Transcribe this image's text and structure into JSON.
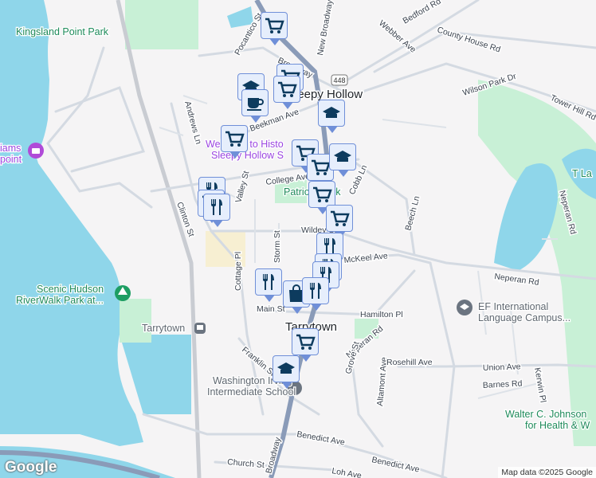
{
  "colors": {
    "water": "#8fd6ea",
    "park": "#c8f0d6",
    "road": "#d4dae2",
    "highway": "#8a9bb8",
    "marker_fill": "#e6eefc",
    "marker_border": "#6f8fd8",
    "marker_icon": "#0d3b5e"
  },
  "labels": {
    "kingsland": "Kingsland Point Park",
    "williams_1": "iams",
    "williams_2": "point",
    "scenic_1": "Scenic Hudson",
    "scenic_2": "RiverWalk Park at...",
    "tarrytown_station": "Tarrytown",
    "welcome_1": "Welcome to Histo",
    "welcome_2": "Sleepy Hollow S",
    "sleepy_hollow": "Sleepy Hollow",
    "patriots_park": "Patriots Park",
    "tarrytown": "Tarrytown",
    "ef_1": "EF International",
    "ef_2": "Language Campus...",
    "wis_1": "Washington Irving",
    "wis_2": "Intermediate School",
    "walter_1": "Walter C. Johnson",
    "walter_2": "for Health & W",
    "tarrytown_lakes": "T La",
    "route": "448"
  },
  "streets": [
    "Pocantico St",
    "Broadway",
    "New Broadway",
    "Webber Ave",
    "Bedford Rd",
    "County House Rd",
    "Wilson Park Dr",
    "Tower Hill Rd",
    "Andrews Ln",
    "Beekman Ave",
    "Clinton St",
    "Valley St",
    "College Ave",
    "Cobb Ln",
    "Beech Ln",
    "Neperan Rd",
    "Wildey St",
    "Cottage Pl",
    "Storm St",
    "McKeel Ave",
    "Main St",
    "Hamilton Pl",
    "Neperan Rd",
    "Grove St",
    "Altamont Ave",
    "Rosehill Ave",
    "Union Ave",
    "Barnes Rd",
    "Kerwin Pl",
    "Franklin St",
    "Benedict Ave",
    "Benedict Ave",
    "Church St",
    "Loh Ave",
    "Broadway",
    "Neperan Rd"
  ],
  "markers": [
    "cart",
    "cart",
    "cart",
    "school",
    "coffee",
    "cart",
    "school",
    "cart",
    "cart",
    "school",
    "cart",
    "cart",
    "restaurant",
    "restaurant",
    "cart",
    "restaurant",
    "restaurant",
    "restaurant",
    "restaurant",
    "shopping",
    "restaurant",
    "cart",
    "school"
  ],
  "attribution": "Map data ©2025 Google",
  "logo": "Google"
}
